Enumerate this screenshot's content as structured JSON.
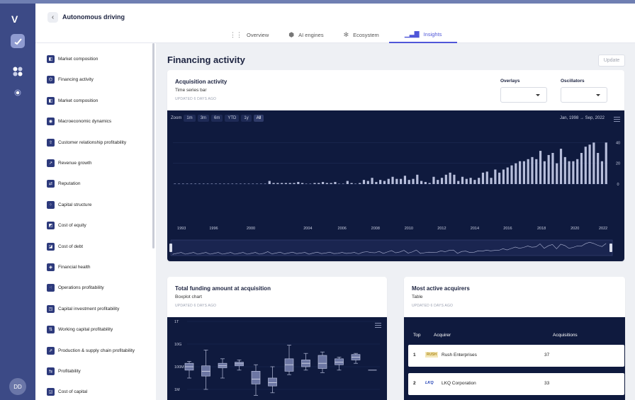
{
  "app": {
    "breadcrumb": "Autonomous driving",
    "avatar_initials": "DD",
    "logo": "V",
    "rail_icons": [
      "chart-icon",
      "apps-icon",
      "dot-icon"
    ]
  },
  "tabs": [
    {
      "label": "Overview",
      "icon": "grid-icon",
      "active": false
    },
    {
      "label": "AI engines",
      "icon": "hexagon-icon",
      "active": false
    },
    {
      "label": "Ecosystem",
      "icon": "atom-icon",
      "active": false
    },
    {
      "label": "Insights",
      "icon": "bars-icon",
      "active": true
    }
  ],
  "sidebar": {
    "items": [
      {
        "label": "Market composition"
      },
      {
        "label": "Financing activity"
      },
      {
        "label": "Market composition"
      },
      {
        "label": "Macroeconomic dynamics"
      },
      {
        "label": "Customer relationship profitability"
      },
      {
        "label": "Revenue growth"
      },
      {
        "label": "Reputation"
      },
      {
        "label": "Capital structure"
      },
      {
        "label": "Cost of equity"
      },
      {
        "label": "Cost of debt"
      },
      {
        "label": "Financial health"
      },
      {
        "label": "Operations profitability"
      },
      {
        "label": "Capital investment profitability"
      },
      {
        "label": "Working capital profitability"
      },
      {
        "label": "Production & supply chain profitability"
      },
      {
        "label": "Profitability"
      },
      {
        "label": "Cost of capital"
      }
    ]
  },
  "main": {
    "title": "Financing activity",
    "update_label": "Update"
  },
  "acquisition": {
    "title": "Acquisition activity",
    "subtitle": "Time series bar",
    "updated": "UPDATED 6 DAYS AGO",
    "overlays_label": "Overlays",
    "oscillators_label": "Oscillators",
    "zoom_label": "Zoom",
    "zoom_options": [
      "1m",
      "3m",
      "6m",
      "YTD",
      "1y",
      "All"
    ],
    "date_from": "Jan, 1998",
    "date_arrow": "→",
    "date_to": "Sep, 2022"
  },
  "funding": {
    "title": "Total funding amount at acquisition",
    "subtitle": "Boxplot chart",
    "updated": "UPDATED 6 DAYS AGO"
  },
  "acquirers": {
    "title": "Most active acquirers",
    "subtitle": "Table",
    "updated": "UPDATED 6 DAYS AGO",
    "columns": [
      "Top",
      "Acquirer",
      "Acquisitions"
    ],
    "rows": [
      {
        "rank": "1",
        "logo": "RUSH",
        "name": "Rush Enterprises",
        "count": "37"
      },
      {
        "rank": "2",
        "logo": "LKQ",
        "name": "LKQ Corporation",
        "count": "33"
      }
    ]
  },
  "chart_data": [
    {
      "type": "bar",
      "title": "Acquisition activity",
      "x_ticks": [
        "1993",
        "1996",
        "2000",
        "2004",
        "2006",
        "2008",
        "2010",
        "2012",
        "2014",
        "2016",
        "2018",
        "2020",
        "2022"
      ],
      "y_ticks": [
        "40",
        "20",
        "0"
      ],
      "ylim": [
        0,
        45
      ],
      "grid": true,
      "values": [
        0,
        0,
        0,
        0,
        0,
        0,
        0,
        0,
        0,
        0,
        0,
        0,
        0,
        0,
        0,
        0,
        0,
        0,
        0,
        0,
        0,
        0,
        0,
        3,
        1,
        1,
        1,
        1,
        1,
        1,
        2,
        1,
        0,
        0,
        1,
        1,
        2,
        1,
        1,
        2,
        0,
        0,
        3,
        1,
        0,
        1,
        4,
        3,
        6,
        2,
        4,
        3,
        5,
        7,
        5,
        5,
        8,
        4,
        5,
        9,
        3,
        2,
        1,
        7,
        4,
        6,
        9,
        11,
        9,
        3,
        7,
        5,
        6,
        4,
        6,
        11,
        12,
        6,
        14,
        11,
        14,
        16,
        18,
        20,
        22,
        22,
        24,
        26,
        24,
        32,
        22,
        28,
        30,
        20,
        34,
        26,
        22,
        22,
        24,
        30,
        36,
        38,
        40,
        30,
        22,
        40
      ]
    },
    {
      "type": "boxplot",
      "title": "Total funding amount at acquisition",
      "y_ticks": [
        "1T",
        "10G",
        "100M",
        "1M"
      ],
      "y_scale": "log",
      "boxes": [
        {
          "q1": 50,
          "median": 100,
          "q3": 200,
          "min": 10,
          "max": 300
        },
        {
          "q1": 15,
          "median": 40,
          "q3": 120,
          "min": 1,
          "max": 3000
        },
        {
          "q1": 80,
          "median": 120,
          "q3": 200,
          "min": 10,
          "max": 500
        },
        {
          "q1": 120,
          "median": 180,
          "q3": 250,
          "min": 50,
          "max": 400
        },
        {
          "q1": 3,
          "median": 8,
          "q3": 40,
          "min": 0.3,
          "max": 150
        },
        {
          "q1": 2,
          "median": 4,
          "q3": 10,
          "min": 0.5,
          "max": 100
        },
        {
          "q1": 40,
          "median": 150,
          "q3": 500,
          "min": 20,
          "max": 8000
        },
        {
          "q1": 100,
          "median": 200,
          "q3": 400,
          "min": 50,
          "max": 1500
        },
        {
          "q1": 70,
          "median": 200,
          "q3": 1000,
          "min": 30,
          "max": 2000
        },
        {
          "q1": 150,
          "median": 250,
          "q3": 500,
          "min": 50,
          "max": 700
        },
        {
          "q1": 400,
          "median": 700,
          "q3": 1200,
          "min": 200,
          "max": 1500
        },
        {
          "q1": 50,
          "median": 50,
          "q3": 50,
          "min": 50,
          "max": 50
        }
      ]
    }
  ],
  "colors": {
    "rail": "#3c4a86",
    "accent": "#4f56d8",
    "chart_bg": "#0f1a3e",
    "bar": "#b7bedb"
  }
}
